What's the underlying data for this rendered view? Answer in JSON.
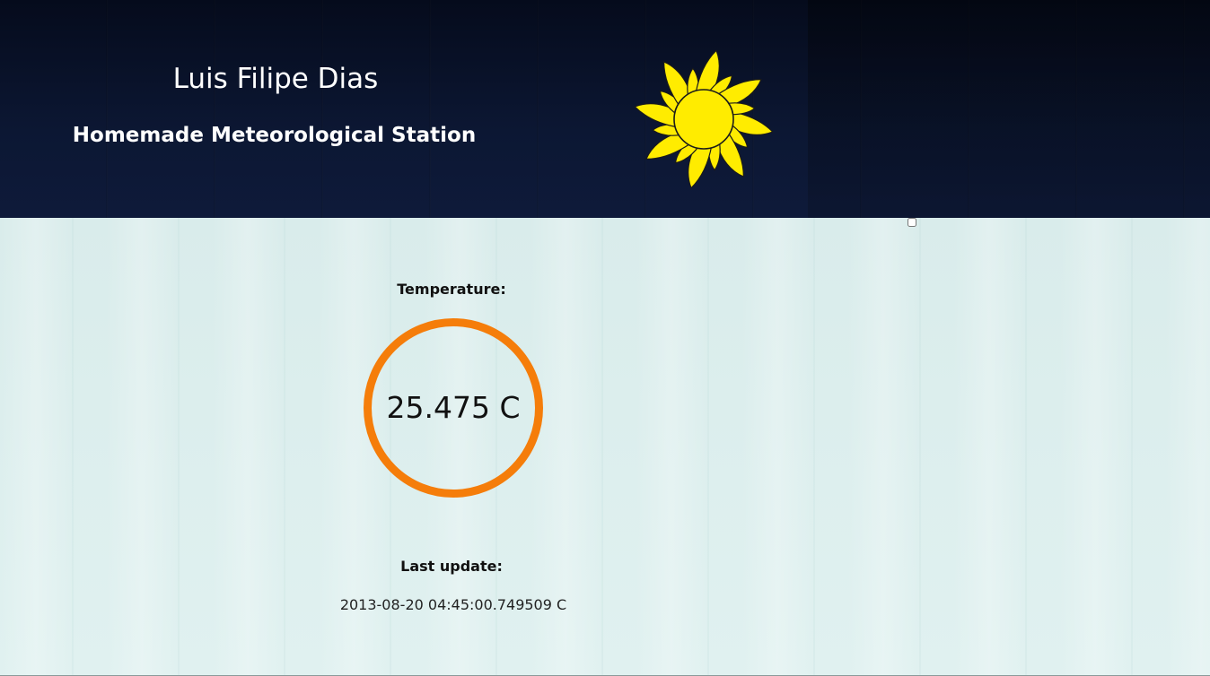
{
  "header": {
    "title": "Luis Filipe Dias",
    "subtitle": "Homemade Meteorological Station",
    "logo_icon": "sun-icon",
    "colors": {
      "background": "#0c1733",
      "sun": "#ffec00",
      "sun_outline": "#1a1a1a"
    }
  },
  "checkbox": {
    "checked": false
  },
  "temperature": {
    "label": "Temperature:",
    "value": "25.475 C",
    "ring_color": "#f57d0a"
  },
  "last_update": {
    "label": "Last update:",
    "value": "2013-08-20 04:45:00.749509 C"
  }
}
